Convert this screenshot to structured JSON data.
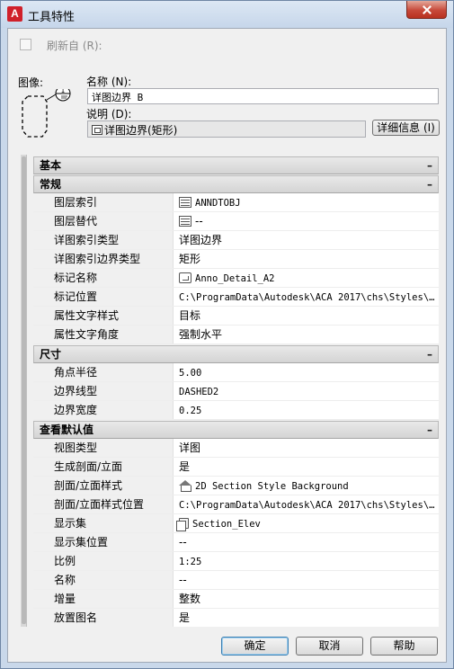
{
  "window": {
    "title": "工具特性",
    "app_icon_letter": "A",
    "close_icon": "close-icon"
  },
  "refresh": {
    "label": "刷新自 (R):",
    "checked": false
  },
  "image_label": "图像:",
  "name": {
    "label": "名称 (N):",
    "value": "详图边界 B"
  },
  "description": {
    "label": "说明 (D):",
    "value": "详图边界(矩形)",
    "details_button": "详细信息 (I)"
  },
  "groups": [
    {
      "title": "基本",
      "collapse": "–",
      "rows": []
    },
    {
      "title": "常规",
      "collapse": "–",
      "rows": [
        {
          "label": "图层索引",
          "value": "ANNDTOBJ",
          "icon": "layer-icon",
          "mono": true
        },
        {
          "label": "图层替代",
          "value": "--",
          "icon": "layer-icon",
          "mono": false
        },
        {
          "label": "详图索引类型",
          "value": "详图边界",
          "icon": "",
          "mono": false
        },
        {
          "label": "详图索引边界类型",
          "value": "矩形",
          "icon": "",
          "mono": false
        },
        {
          "label": "标记名称",
          "value": "Anno_Detail_A2",
          "icon": "tag-icon",
          "mono": true
        },
        {
          "label": "标记位置",
          "value": "C:\\ProgramData\\Autodesk\\ACA  2017\\chs\\Styles\\…",
          "icon": "",
          "mono": true
        },
        {
          "label": "属性文字样式",
          "value": "目标",
          "icon": "",
          "mono": false
        },
        {
          "label": "属性文字角度",
          "value": "强制水平",
          "icon": "",
          "mono": false
        }
      ]
    },
    {
      "title": "尺寸",
      "collapse": "–",
      "rows": [
        {
          "label": "角点半径",
          "value": "5.00",
          "icon": "",
          "mono": true
        },
        {
          "label": "边界线型",
          "value": "DASHED2",
          "icon": "",
          "mono": true
        },
        {
          "label": "边界宽度",
          "value": "0.25",
          "icon": "",
          "mono": true
        }
      ]
    },
    {
      "title": "查看默认值",
      "collapse": "–",
      "rows": [
        {
          "label": "视图类型",
          "value": "详图",
          "icon": "",
          "mono": false
        },
        {
          "label": "生成剖面/立面",
          "value": "是",
          "icon": "",
          "mono": false
        },
        {
          "label": "剖面/立面样式",
          "value": "2D Section Style Background",
          "icon": "house-icon",
          "mono": true
        },
        {
          "label": "剖面/立面样式位置",
          "value": "C:\\ProgramData\\Autodesk\\ACA  2017\\chs\\Styles\\…",
          "icon": "",
          "mono": true
        },
        {
          "label": "显示集",
          "value": "Section_Elev",
          "icon": "page-icon",
          "mono": true
        },
        {
          "label": "显示集位置",
          "value": "--",
          "icon": "",
          "mono": false
        },
        {
          "label": "比例",
          "value": "1:25",
          "icon": "",
          "mono": true
        },
        {
          "label": "名称",
          "value": "--",
          "icon": "",
          "mono": false
        },
        {
          "label": "增量",
          "value": "整数",
          "icon": "",
          "mono": false
        },
        {
          "label": "放置图名",
          "value": "是",
          "icon": "",
          "mono": false
        }
      ]
    }
  ],
  "buttons": {
    "ok": "确定",
    "cancel": "取消",
    "help": "帮助"
  },
  "preview_tag": "1"
}
